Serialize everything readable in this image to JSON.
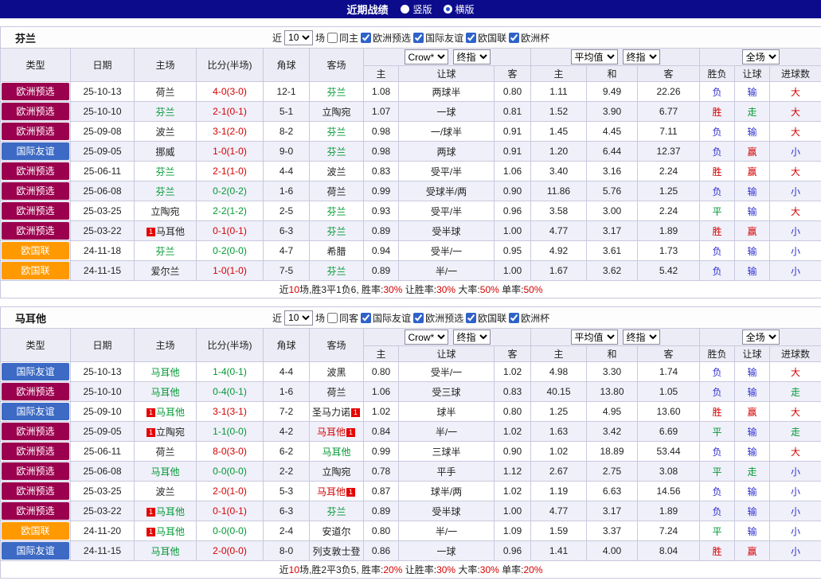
{
  "colors": {
    "red": "#d50000",
    "green": "#009933",
    "blue": "#3030d0",
    "dark": "#222222"
  },
  "comp_colors": {
    "欧洲预选": "#9b004e",
    "国际友谊": "#3c6ac4",
    "欧国联": "#ff9900"
  },
  "top_bar": {
    "title": "近期战绩",
    "radios": [
      {
        "label": "竖版",
        "selected": false
      },
      {
        "label": "横版",
        "selected": true
      }
    ]
  },
  "sections": [
    {
      "team": "芬兰",
      "filter": {
        "near": "近",
        "count": "10",
        "games": "场",
        "same": {
          "label": "同主",
          "checked": false
        },
        "comps": [
          {
            "label": "欧洲预选",
            "checked": true
          },
          {
            "label": "国际友谊",
            "checked": true
          },
          {
            "label": "欧国联",
            "checked": true
          },
          {
            "label": "欧洲杯",
            "checked": true
          }
        ]
      },
      "header": {
        "cols": [
          "类型",
          "日期",
          "主场",
          "比分(半场)",
          "角球",
          "客场"
        ],
        "odds_select": "Crow*",
        "odds_final_select": "终指",
        "avg_select": "平均值",
        "avg_final_select": "终指",
        "scope_select": "全场",
        "sub": [
          "主",
          "让球",
          "客",
          "主",
          "和",
          "客",
          "胜负",
          "让球",
          "进球数"
        ]
      },
      "rows": [
        {
          "comp": "欧洲预选",
          "date": "25-10-13",
          "home": {
            "n": "荷兰",
            "c": "dark"
          },
          "score": {
            "t": "4-0(3-0)",
            "c": "red"
          },
          "corner": "12-1",
          "away": {
            "n": "芬兰",
            "c": "green"
          },
          "odds": [
            "1.08",
            "两球半",
            "0.80"
          ],
          "avg": [
            "1.11",
            "9.49",
            "22.26"
          ],
          "res": [
            [
              "负",
              "blue"
            ],
            [
              "输",
              "blue"
            ],
            [
              "大",
              "red"
            ]
          ]
        },
        {
          "comp": "欧洲预选",
          "date": "25-10-10",
          "home": {
            "n": "芬兰",
            "c": "green"
          },
          "score": {
            "t": "2-1(0-1)",
            "c": "red"
          },
          "corner": "5-1",
          "away": {
            "n": "立陶宛",
            "c": "dark"
          },
          "odds": [
            "1.07",
            "一球",
            "0.81"
          ],
          "avg": [
            "1.52",
            "3.90",
            "6.77"
          ],
          "res": [
            [
              "胜",
              "red"
            ],
            [
              "走",
              "green"
            ],
            [
              "大",
              "red"
            ]
          ]
        },
        {
          "comp": "欧洲预选",
          "date": "25-09-08",
          "home": {
            "n": "波兰",
            "c": "dark"
          },
          "score": {
            "t": "3-1(2-0)",
            "c": "red"
          },
          "corner": "8-2",
          "away": {
            "n": "芬兰",
            "c": "green"
          },
          "odds": [
            "0.98",
            "一/球半",
            "0.91"
          ],
          "avg": [
            "1.45",
            "4.45",
            "7.11"
          ],
          "res": [
            [
              "负",
              "blue"
            ],
            [
              "输",
              "blue"
            ],
            [
              "大",
              "red"
            ]
          ]
        },
        {
          "comp": "国际友谊",
          "date": "25-09-05",
          "home": {
            "n": "挪威",
            "c": "dark"
          },
          "score": {
            "t": "1-0(1-0)",
            "c": "red"
          },
          "corner": "9-0",
          "away": {
            "n": "芬兰",
            "c": "green"
          },
          "odds": [
            "0.98",
            "两球",
            "0.91"
          ],
          "avg": [
            "1.20",
            "6.44",
            "12.37"
          ],
          "res": [
            [
              "负",
              "blue"
            ],
            [
              "赢",
              "red"
            ],
            [
              "小",
              "blue"
            ]
          ]
        },
        {
          "comp": "欧洲预选",
          "date": "25-06-11",
          "home": {
            "n": "芬兰",
            "c": "green"
          },
          "score": {
            "t": "2-1(1-0)",
            "c": "red"
          },
          "corner": "4-4",
          "away": {
            "n": "波兰",
            "c": "dark"
          },
          "odds": [
            "0.83",
            "受平/半",
            "1.06"
          ],
          "avg": [
            "3.40",
            "3.16",
            "2.24"
          ],
          "res": [
            [
              "胜",
              "red"
            ],
            [
              "赢",
              "red"
            ],
            [
              "大",
              "red"
            ]
          ]
        },
        {
          "comp": "欧洲预选",
          "date": "25-06-08",
          "home": {
            "n": "芬兰",
            "c": "green"
          },
          "score": {
            "t": "0-2(0-2)",
            "c": "green"
          },
          "corner": "1-6",
          "away": {
            "n": "荷兰",
            "c": "dark"
          },
          "odds": [
            "0.99",
            "受球半/两",
            "0.90"
          ],
          "avg": [
            "11.86",
            "5.76",
            "1.25"
          ],
          "res": [
            [
              "负",
              "blue"
            ],
            [
              "输",
              "blue"
            ],
            [
              "小",
              "blue"
            ]
          ]
        },
        {
          "comp": "欧洲预选",
          "date": "25-03-25",
          "home": {
            "n": "立陶宛",
            "c": "dark"
          },
          "score": {
            "t": "2-2(1-2)",
            "c": "green"
          },
          "corner": "2-5",
          "away": {
            "n": "芬兰",
            "c": "green"
          },
          "odds": [
            "0.93",
            "受平/半",
            "0.96"
          ],
          "avg": [
            "3.58",
            "3.00",
            "2.24"
          ],
          "res": [
            [
              "平",
              "green"
            ],
            [
              "输",
              "blue"
            ],
            [
              "大",
              "red"
            ]
          ]
        },
        {
          "comp": "欧洲预选",
          "date": "25-03-22",
          "home": {
            "n": "马耳他",
            "c": "dark",
            "card_pre": true
          },
          "score": {
            "t": "0-1(0-1)",
            "c": "red"
          },
          "corner": "6-3",
          "away": {
            "n": "芬兰",
            "c": "green"
          },
          "odds": [
            "0.89",
            "受半球",
            "1.00"
          ],
          "avg": [
            "4.77",
            "3.17",
            "1.89"
          ],
          "res": [
            [
              "胜",
              "red"
            ],
            [
              "赢",
              "red"
            ],
            [
              "小",
              "blue"
            ]
          ]
        },
        {
          "comp": "欧国联",
          "date": "24-11-18",
          "home": {
            "n": "芬兰",
            "c": "green"
          },
          "score": {
            "t": "0-2(0-0)",
            "c": "green"
          },
          "corner": "4-7",
          "away": {
            "n": "希腊",
            "c": "dark"
          },
          "odds": [
            "0.94",
            "受半/一",
            "0.95"
          ],
          "avg": [
            "4.92",
            "3.61",
            "1.73"
          ],
          "res": [
            [
              "负",
              "blue"
            ],
            [
              "输",
              "blue"
            ],
            [
              "小",
              "blue"
            ]
          ]
        },
        {
          "comp": "欧国联",
          "date": "24-11-15",
          "home": {
            "n": "爱尔兰",
            "c": "dark"
          },
          "score": {
            "t": "1-0(1-0)",
            "c": "red"
          },
          "corner": "7-5",
          "away": {
            "n": "芬兰",
            "c": "green"
          },
          "odds": [
            "0.89",
            "半/一",
            "1.00"
          ],
          "avg": [
            "1.67",
            "3.62",
            "5.42"
          ],
          "res": [
            [
              "负",
              "blue"
            ],
            [
              "输",
              "blue"
            ],
            [
              "小",
              "blue"
            ]
          ]
        }
      ],
      "summary": [
        [
          "近",
          "dark"
        ],
        [
          "10",
          "red"
        ],
        [
          "场,胜3平1负6, 胜率:",
          "dark"
        ],
        [
          "30%",
          "red"
        ],
        [
          "  让胜率:",
          "dark"
        ],
        [
          "30%",
          "red"
        ],
        [
          "  大率:",
          "dark"
        ],
        [
          "50%",
          "red"
        ],
        [
          "  单率:",
          "dark"
        ],
        [
          "50%",
          "red"
        ]
      ]
    },
    {
      "team": "马耳他",
      "filter": {
        "near": "近",
        "count": "10",
        "games": "场",
        "same": {
          "label": "同客",
          "checked": false
        },
        "comps": [
          {
            "label": "国际友谊",
            "checked": true
          },
          {
            "label": "欧洲预选",
            "checked": true
          },
          {
            "label": "欧国联",
            "checked": true
          },
          {
            "label": "欧洲杯",
            "checked": true
          }
        ]
      },
      "header": {
        "cols": [
          "类型",
          "日期",
          "主场",
          "比分(半场)",
          "角球",
          "客场"
        ],
        "odds_select": "Crow*",
        "odds_final_select": "终指",
        "avg_select": "平均值",
        "avg_final_select": "终指",
        "scope_select": "全场",
        "sub": [
          "主",
          "让球",
          "客",
          "主",
          "和",
          "客",
          "胜负",
          "让球",
          "进球数"
        ]
      },
      "rows": [
        {
          "comp": "国际友谊",
          "date": "25-10-13",
          "home": {
            "n": "马耳他",
            "c": "green"
          },
          "score": {
            "t": "1-4(0-1)",
            "c": "green"
          },
          "corner": "4-4",
          "away": {
            "n": "波黑",
            "c": "dark"
          },
          "odds": [
            "0.80",
            "受半/一",
            "1.02"
          ],
          "avg": [
            "4.98",
            "3.30",
            "1.74"
          ],
          "res": [
            [
              "负",
              "blue"
            ],
            [
              "输",
              "blue"
            ],
            [
              "大",
              "red"
            ]
          ]
        },
        {
          "comp": "欧洲预选",
          "date": "25-10-10",
          "home": {
            "n": "马耳他",
            "c": "green"
          },
          "score": {
            "t": "0-4(0-1)",
            "c": "green"
          },
          "corner": "1-6",
          "away": {
            "n": "荷兰",
            "c": "dark"
          },
          "odds": [
            "1.06",
            "受三球",
            "0.83"
          ],
          "avg": [
            "40.15",
            "13.80",
            "1.05"
          ],
          "res": [
            [
              "负",
              "blue"
            ],
            [
              "输",
              "blue"
            ],
            [
              "走",
              "green"
            ]
          ]
        },
        {
          "comp": "国际友谊",
          "date": "25-09-10",
          "home": {
            "n": "马耳他",
            "c": "green",
            "card_pre": true
          },
          "score": {
            "t": "3-1(3-1)",
            "c": "red"
          },
          "corner": "7-2",
          "away": {
            "n": "圣马力诺",
            "c": "dark",
            "card_post": true
          },
          "odds": [
            "1.02",
            "球半",
            "0.80"
          ],
          "avg": [
            "1.25",
            "4.95",
            "13.60"
          ],
          "res": [
            [
              "胜",
              "red"
            ],
            [
              "赢",
              "red"
            ],
            [
              "大",
              "red"
            ]
          ]
        },
        {
          "comp": "欧洲预选",
          "date": "25-09-05",
          "home": {
            "n": "立陶宛",
            "c": "dark",
            "card_pre": true
          },
          "score": {
            "t": "1-1(0-0)",
            "c": "green"
          },
          "corner": "4-2",
          "away": {
            "n": "马耳他",
            "c": "red",
            "card_post": true
          },
          "odds": [
            "0.84",
            "半/一",
            "1.02"
          ],
          "avg": [
            "1.63",
            "3.42",
            "6.69"
          ],
          "res": [
            [
              "平",
              "green"
            ],
            [
              "输",
              "blue"
            ],
            [
              "走",
              "green"
            ]
          ]
        },
        {
          "comp": "欧洲预选",
          "date": "25-06-11",
          "home": {
            "n": "荷兰",
            "c": "dark"
          },
          "score": {
            "t": "8-0(3-0)",
            "c": "red"
          },
          "corner": "6-2",
          "away": {
            "n": "马耳他",
            "c": "green"
          },
          "odds": [
            "0.99",
            "三球半",
            "0.90"
          ],
          "avg": [
            "1.02",
            "18.89",
            "53.44"
          ],
          "res": [
            [
              "负",
              "blue"
            ],
            [
              "输",
              "blue"
            ],
            [
              "大",
              "red"
            ]
          ]
        },
        {
          "comp": "欧洲预选",
          "date": "25-06-08",
          "home": {
            "n": "马耳他",
            "c": "green"
          },
          "score": {
            "t": "0-0(0-0)",
            "c": "green"
          },
          "corner": "2-2",
          "away": {
            "n": "立陶宛",
            "c": "dark"
          },
          "odds": [
            "0.78",
            "平手",
            "1.12"
          ],
          "avg": [
            "2.67",
            "2.75",
            "3.08"
          ],
          "res": [
            [
              "平",
              "green"
            ],
            [
              "走",
              "green"
            ],
            [
              "小",
              "blue"
            ]
          ]
        },
        {
          "comp": "欧洲预选",
          "date": "25-03-25",
          "home": {
            "n": "波兰",
            "c": "dark"
          },
          "score": {
            "t": "2-0(1-0)",
            "c": "red"
          },
          "corner": "5-3",
          "away": {
            "n": "马耳他",
            "c": "red",
            "card_post": true
          },
          "odds": [
            "0.87",
            "球半/两",
            "1.02"
          ],
          "avg": [
            "1.19",
            "6.63",
            "14.56"
          ],
          "res": [
            [
              "负",
              "blue"
            ],
            [
              "输",
              "blue"
            ],
            [
              "小",
              "blue"
            ]
          ]
        },
        {
          "comp": "欧洲预选",
          "date": "25-03-22",
          "home": {
            "n": "马耳他",
            "c": "green",
            "card_pre": true
          },
          "score": {
            "t": "0-1(0-1)",
            "c": "red"
          },
          "corner": "6-3",
          "away": {
            "n": "芬兰",
            "c": "green"
          },
          "odds": [
            "0.89",
            "受半球",
            "1.00"
          ],
          "avg": [
            "4.77",
            "3.17",
            "1.89"
          ],
          "res": [
            [
              "负",
              "blue"
            ],
            [
              "输",
              "blue"
            ],
            [
              "小",
              "blue"
            ]
          ]
        },
        {
          "comp": "欧国联",
          "date": "24-11-20",
          "home": {
            "n": "马耳他",
            "c": "green",
            "card_pre": true
          },
          "score": {
            "t": "0-0(0-0)",
            "c": "green"
          },
          "corner": "2-4",
          "away": {
            "n": "安道尔",
            "c": "dark"
          },
          "odds": [
            "0.80",
            "半/一",
            "1.09"
          ],
          "avg": [
            "1.59",
            "3.37",
            "7.24"
          ],
          "res": [
            [
              "平",
              "green"
            ],
            [
              "输",
              "blue"
            ],
            [
              "小",
              "blue"
            ]
          ]
        },
        {
          "comp": "国际友谊",
          "date": "24-11-15",
          "home": {
            "n": "马耳他",
            "c": "green"
          },
          "score": {
            "t": "2-0(0-0)",
            "c": "red"
          },
          "corner": "8-0",
          "away": {
            "n": "列支敦士登",
            "c": "dark"
          },
          "odds": [
            "0.86",
            "一球",
            "0.96"
          ],
          "avg": [
            "1.41",
            "4.00",
            "8.04"
          ],
          "res": [
            [
              "胜",
              "red"
            ],
            [
              "赢",
              "red"
            ],
            [
              "小",
              "blue"
            ]
          ]
        }
      ],
      "summary": [
        [
          "近",
          "dark"
        ],
        [
          "10",
          "red"
        ],
        [
          "场,胜2平3负5, 胜率:",
          "dark"
        ],
        [
          "20%",
          "red"
        ],
        [
          "  让胜率:",
          "dark"
        ],
        [
          "30%",
          "red"
        ],
        [
          "  大率:",
          "dark"
        ],
        [
          "30%",
          "red"
        ],
        [
          "  单率:",
          "dark"
        ],
        [
          "20%",
          "red"
        ]
      ]
    }
  ]
}
